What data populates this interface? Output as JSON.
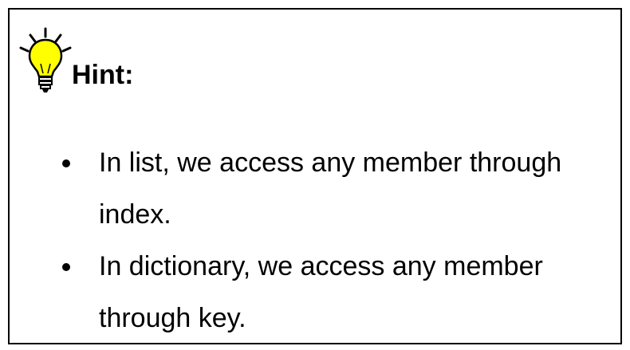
{
  "hint": {
    "icon": "lightbulb-icon",
    "title": "Hint:",
    "items": [
      {
        "text": "In list, we access any member through index."
      },
      {
        "text": "In dictionary, we access any member through key."
      }
    ]
  },
  "colors": {
    "bulb": "#FFFF00",
    "border": "#000000",
    "text": "#000000"
  }
}
